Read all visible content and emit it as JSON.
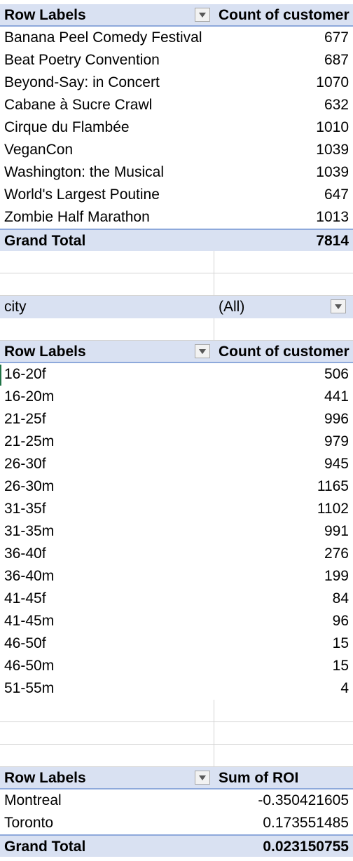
{
  "pivot1": {
    "header": {
      "row_labels": "Row Labels",
      "value_label": "Count of customer"
    },
    "rows": [
      {
        "label": "Banana Peel Comedy Festival",
        "value": "677"
      },
      {
        "label": "Beat Poetry Convention",
        "value": "687"
      },
      {
        "label": "Beyond-Say: in Concert",
        "value": "1070"
      },
      {
        "label": "Cabane à Sucre Crawl",
        "value": "632"
      },
      {
        "label": "Cirque du Flambée",
        "value": "1010"
      },
      {
        "label": "VeganCon",
        "value": "1039"
      },
      {
        "label": "Washington: the Musical",
        "value": "1039"
      },
      {
        "label": "World's Largest Poutine",
        "value": "647"
      },
      {
        "label": "Zombie Half Marathon",
        "value": "1013"
      }
    ],
    "total": {
      "label": "Grand Total",
      "value": "7814"
    }
  },
  "filter": {
    "label": "city",
    "value": "(All)"
  },
  "pivot2": {
    "header": {
      "row_labels": "Row Labels",
      "value_label": "Count of customer"
    },
    "rows": [
      {
        "label": "16-20f",
        "value": "506"
      },
      {
        "label": "16-20m",
        "value": "441"
      },
      {
        "label": "21-25f",
        "value": "996"
      },
      {
        "label": "21-25m",
        "value": "979"
      },
      {
        "label": "26-30f",
        "value": "945"
      },
      {
        "label": "26-30m",
        "value": "1165"
      },
      {
        "label": "31-35f",
        "value": "1102"
      },
      {
        "label": "31-35m",
        "value": "991"
      },
      {
        "label": "36-40f",
        "value": "276"
      },
      {
        "label": "36-40m",
        "value": "199"
      },
      {
        "label": "41-45f",
        "value": "84"
      },
      {
        "label": "41-45m",
        "value": "96"
      },
      {
        "label": "46-50f",
        "value": "15"
      },
      {
        "label": "46-50m",
        "value": "15"
      },
      {
        "label": "51-55m",
        "value": "4"
      }
    ]
  },
  "pivot3": {
    "header": {
      "row_labels": "Row Labels",
      "value_label": "Sum of ROI"
    },
    "rows": [
      {
        "label": "Montreal",
        "value": "-0.350421605"
      },
      {
        "label": "Toronto",
        "value": "0.173551485"
      }
    ],
    "total": {
      "label": "Grand Total",
      "value": "0.023150755"
    }
  },
  "icons": {
    "dropdown": "dropdown-arrow-icon"
  },
  "colors": {
    "header_fill": "#d9e1f2",
    "header_border": "#8ea9db"
  }
}
